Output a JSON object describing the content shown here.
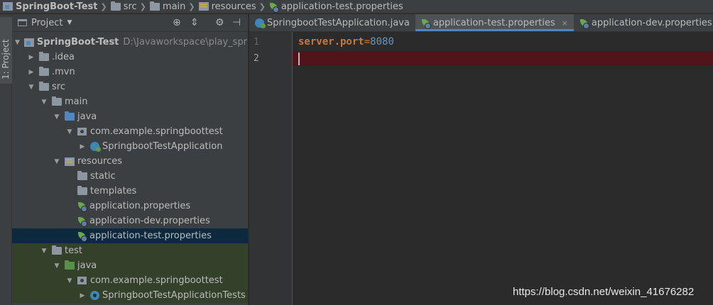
{
  "breadcrumb": [
    "SpringBoot-Test",
    "src",
    "main",
    "resources",
    "application-test.properties"
  ],
  "sidebar": {
    "label": "1: Project"
  },
  "panel": {
    "title": "Project",
    "tree": [
      {
        "label": "SpringBoot-Test",
        "path": "D:\\Javaworkspace\\play_springboot",
        "icon": "module-icon",
        "expanded": true
      },
      {
        "label": ".idea",
        "icon": "folder-icon",
        "expanded": false
      },
      {
        "label": ".mvn",
        "icon": "folder-icon",
        "expanded": false
      },
      {
        "label": "src",
        "icon": "folder-icon",
        "expanded": true
      },
      {
        "label": "main",
        "icon": "folder-icon",
        "expanded": true
      },
      {
        "label": "java",
        "icon": "source-folder-icon",
        "expanded": true
      },
      {
        "label": "com.example.springboottest",
        "icon": "package-icon",
        "expanded": true
      },
      {
        "label": "SpringbootTestApplication",
        "icon": "spring-boot-class-icon",
        "expanded": false
      },
      {
        "label": "resources",
        "icon": "resources-folder-icon",
        "expanded": true
      },
      {
        "label": "static",
        "icon": "folder-icon"
      },
      {
        "label": "templates",
        "icon": "folder-icon"
      },
      {
        "label": "application.properties",
        "icon": "spring-properties-icon"
      },
      {
        "label": "application-dev.properties",
        "icon": "spring-properties-icon"
      },
      {
        "label": "application-test.properties",
        "icon": "spring-properties-icon",
        "selected": true
      },
      {
        "label": "test",
        "icon": "folder-icon",
        "expanded": true
      },
      {
        "label": "java",
        "icon": "test-source-folder-icon",
        "expanded": true
      },
      {
        "label": "com.example.springboottest",
        "icon": "package-icon",
        "expanded": true
      },
      {
        "label": "SpringbootTestApplicationTests",
        "icon": "test-class-icon",
        "expanded": false
      }
    ]
  },
  "tabs": [
    {
      "label": "SpringbootTestApplication.java",
      "icon": "spring-boot-class-icon",
      "active": false
    },
    {
      "label": "application-test.properties",
      "icon": "spring-properties-icon",
      "active": true,
      "close": "×"
    },
    {
      "label": "application-dev.properties",
      "icon": "spring-properties-icon",
      "active": false
    }
  ],
  "editor": {
    "lines": [
      "1",
      "2"
    ],
    "code": {
      "key": "server.port",
      "eq": "=",
      "value": "8080"
    }
  },
  "watermark": "https://blog.csdn.net/weixin_41676282",
  "colors": {
    "panel_bg": "#3c3f41",
    "editor_bg": "#2b2b2b",
    "selection": "#0d293e",
    "error_line": "#52141b",
    "keyword": "#cc7832",
    "number": "#6897bb",
    "tab_active_underline": "#4a88c7"
  }
}
